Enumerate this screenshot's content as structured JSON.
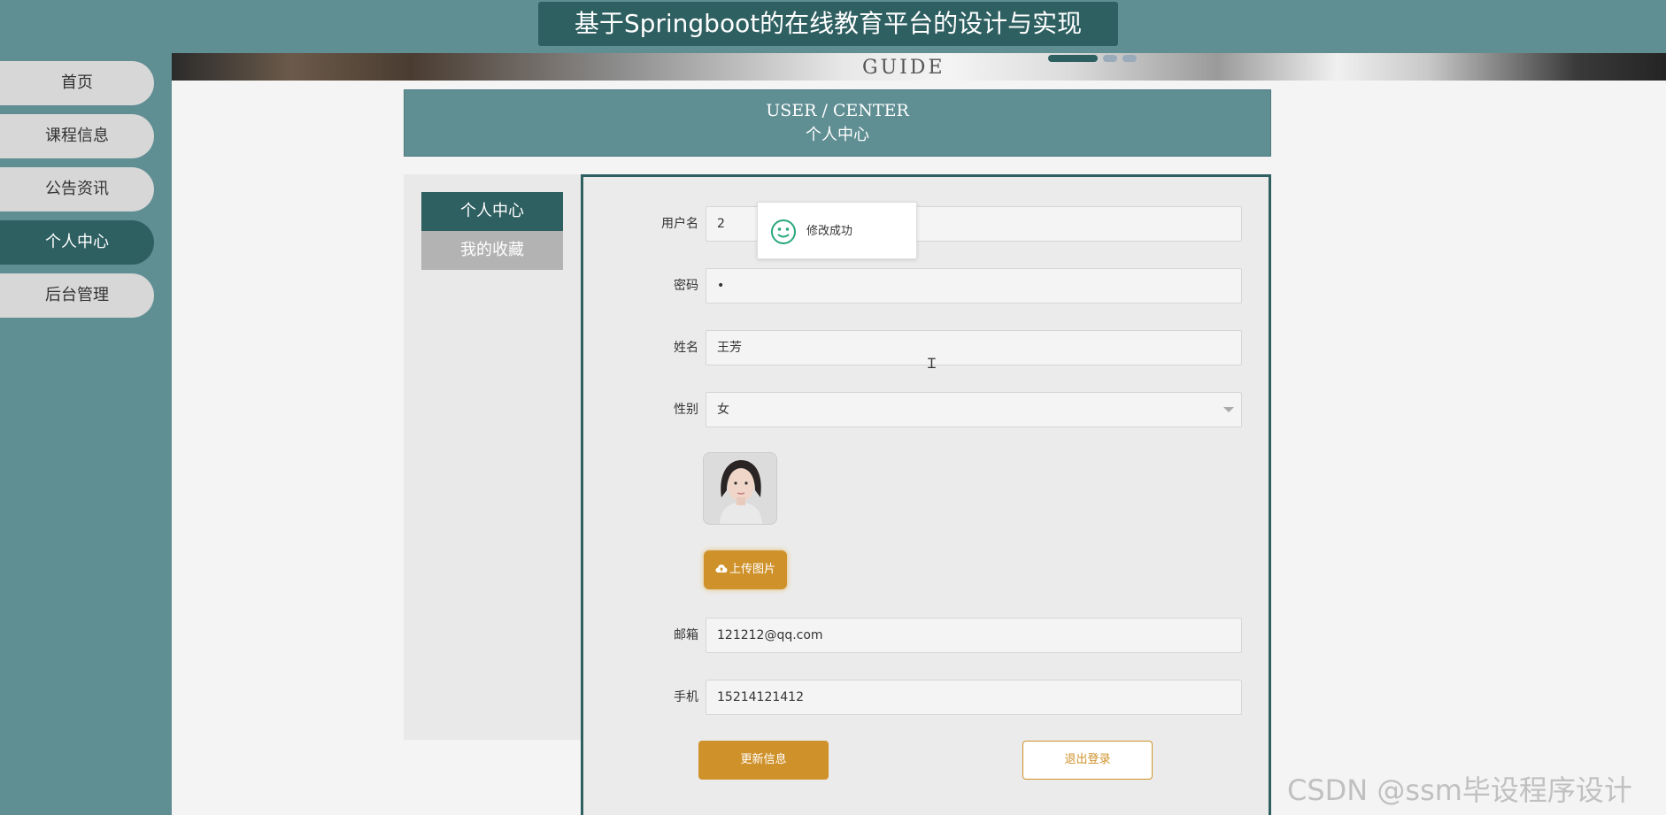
{
  "app": {
    "title": "基于Springboot的在线教育平台的设计与实现"
  },
  "sidebar": {
    "items": [
      {
        "label": "首页",
        "active": false
      },
      {
        "label": "课程信息",
        "active": false
      },
      {
        "label": "公告资讯",
        "active": false
      },
      {
        "label": "个人中心",
        "active": true
      },
      {
        "label": "后台管理",
        "active": false
      }
    ]
  },
  "banner": {
    "text": "GUIDE"
  },
  "header": {
    "en": "USER / CENTER",
    "cn": "个人中心"
  },
  "inner_menu": {
    "items": [
      {
        "label": "个人中心",
        "active": true
      },
      {
        "label": "我的收藏",
        "active": false
      }
    ]
  },
  "form": {
    "username": {
      "label": "用户名",
      "value": "2"
    },
    "password": {
      "label": "密码",
      "value": "•"
    },
    "name": {
      "label": "姓名",
      "value": "王芳"
    },
    "gender": {
      "label": "性别",
      "value": "女"
    },
    "email": {
      "label": "邮箱",
      "value": "121212@qq.com"
    },
    "phone": {
      "label": "手机",
      "value": "15214121412"
    },
    "upload_label": "上传图片",
    "update_label": "更新信息",
    "logout_label": "退出登录"
  },
  "toast": {
    "message": "修改成功"
  },
  "watermark": {
    "text": "CSDN @ssm毕设程序设计"
  },
  "colors": {
    "primary": "#5f8e93",
    "dark": "#2e5f61",
    "accent": "#cf922b",
    "toast_icon": "#2aa87a"
  },
  "icons": {
    "upload": "cloud-upload-icon",
    "toast": "smile-icon",
    "select": "chevron-down-icon"
  }
}
